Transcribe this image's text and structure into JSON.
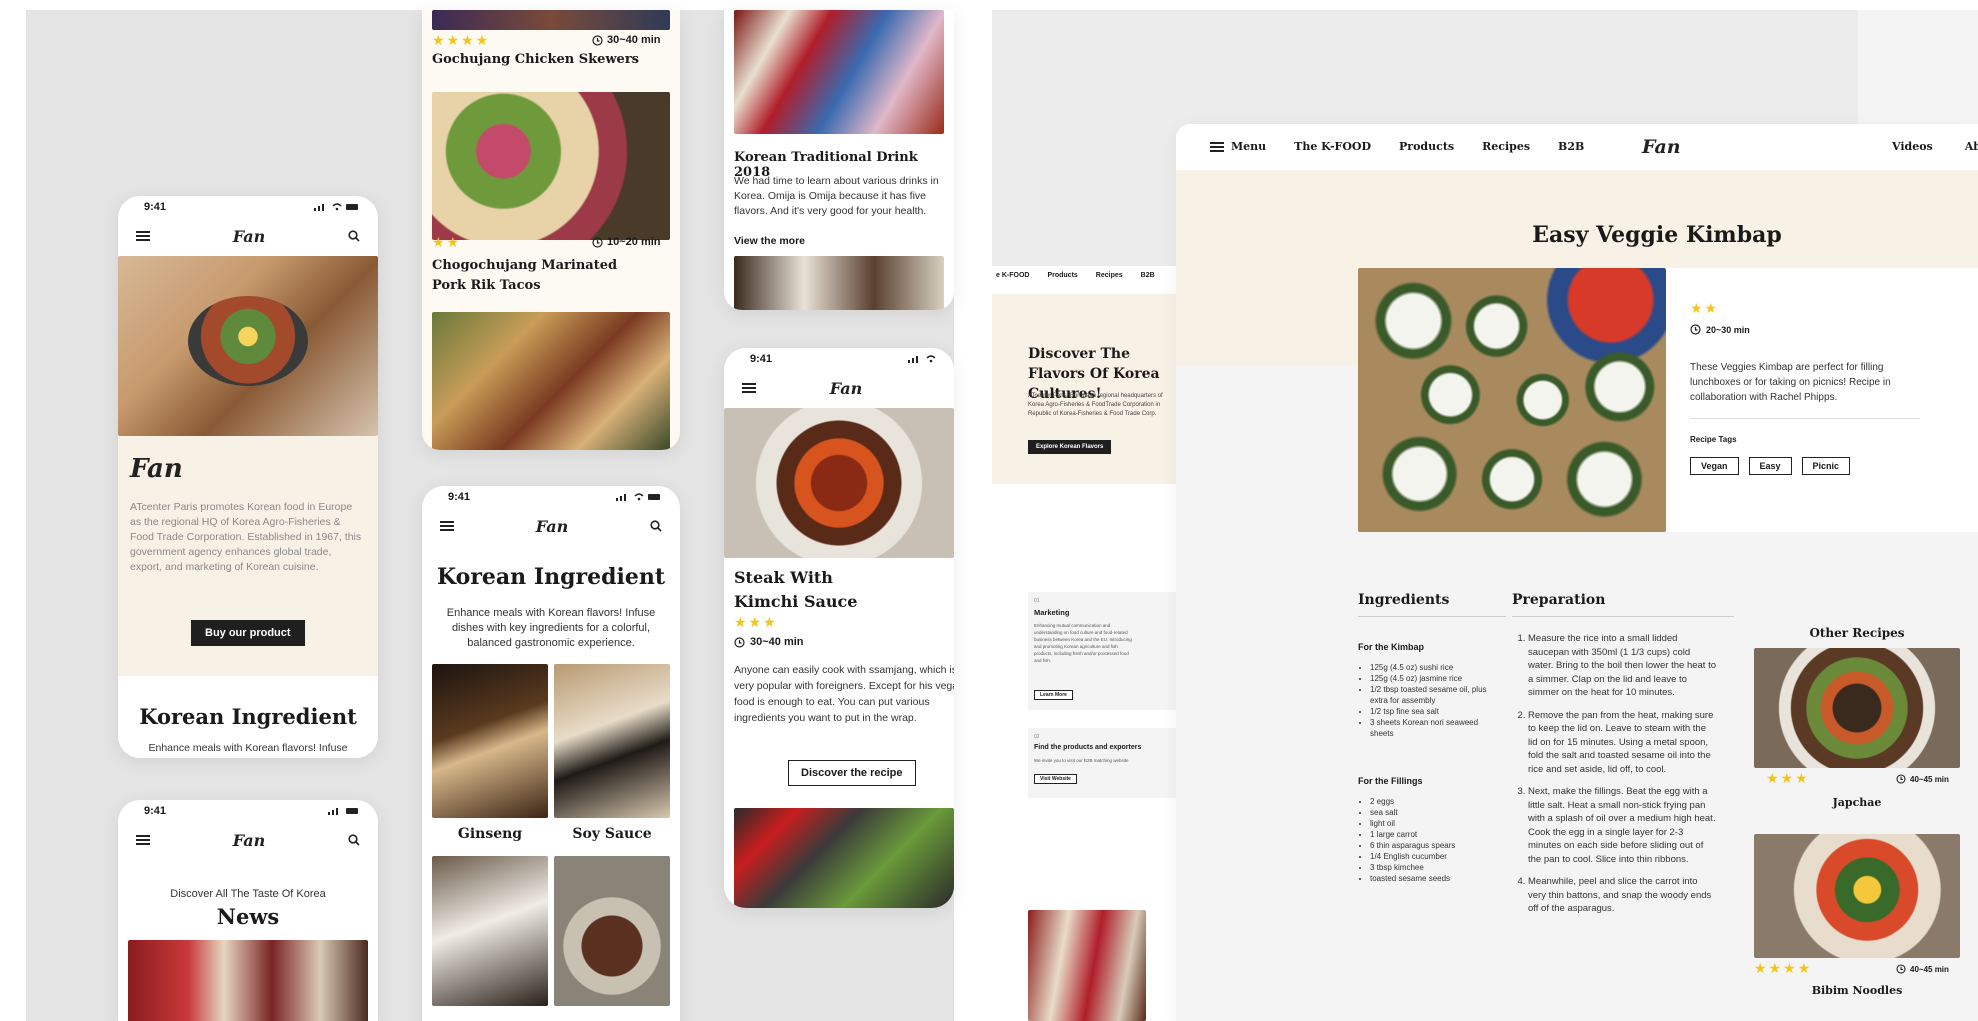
{
  "colors": {
    "accent_star": "#f3c51a",
    "cream": "#f8f1e6",
    "dark_button": "#1f1f1f",
    "page_bg": "#e6e6e6"
  },
  "phone_home": {
    "time": "9:41",
    "logo": "Fan",
    "about_logo": "Fan",
    "about_text": "ATcenter Paris promotes Korean food in Europe as the regional HQ of Korea Agro-Fisheries & Food Trade Corporation. Established in 1967, this government agency enhances global trade, export, and marketing of Korean cuisine.",
    "buy_button": "Buy our product",
    "section_title": "Korean Ingredient",
    "section_sub": "Enhance meals with Korean flavors! Infuse"
  },
  "phone_news": {
    "time": "9:41",
    "logo": "Fan",
    "kicker": "Discover All The Taste Of Korea",
    "title": "News"
  },
  "recipes_column": {
    "r1_stars": "★★★★",
    "r1_time": "30~40 min",
    "r1_title": "Gochujang Chicken Skewers",
    "r2_stars": "★★",
    "r2_time": "10~20 min",
    "r2_title": "Chogochujang Marinated Pork Rik Tacos"
  },
  "phone_ingredient": {
    "time": "9:41",
    "logo": "Fan",
    "title": "Korean Ingredient",
    "desc": "Enhance meals with Korean flavors! Infuse dishes with key ingredients for a colorful, balanced gastronomic experience.",
    "items": [
      {
        "label": "Ginseng"
      },
      {
        "label": "Soy Sauce"
      }
    ]
  },
  "drink_card": {
    "title": "Korean Traditional Drink 2018",
    "desc": "We had time to learn about various drinks in Korea. Omija is Omija because it has five flavors. And it's very good for your health.",
    "link": "View the more"
  },
  "phone_steak": {
    "time": "9:41",
    "logo": "Fan",
    "title": "Steak With Kimchi Sauce",
    "stars": "★★★",
    "time_label": "30~40 min",
    "desc": "Anyone can easily cook with ssamjang, which is very popular with foreigners. Except for his vegan food is enough to eat. You can put various ingredients you want to put in the wrap.",
    "button": "Discover the recipe"
  },
  "desktop_mid": {
    "nav": [
      "e K-FOOD",
      "Products",
      "Recipes",
      "B2B"
    ],
    "hero_title": "Discover The Flavors Of Korea Cultures!",
    "hero_desc": "ATcenter Paris, European regional headquarters of Korea Agro-Fisheries & FoodTrade Corporation in Republic of Korea-Fisheries & Food Trade Corp.",
    "hero_button": "Explore Korean Flavors",
    "card1_num": "01",
    "card1_title": "Marketing",
    "card1_desc": "Enhancing mutual communication and understanding on food culture and food-related business between Korea and the EU. Introducing and promoting Korean agriculture and fish products, including fresh and/or processed food and fish.",
    "card1_button": "Learn More",
    "card2_num": "02",
    "card2_title": "Find the products and exporters",
    "card2_desc": "We invite you to visit our B2B matching website",
    "card2_button": "Visit Website"
  },
  "desktop_main": {
    "nav_left": [
      "Menu",
      "The K-FOOD",
      "Products",
      "Recipes",
      "B2B"
    ],
    "logo": "Fan",
    "nav_right": [
      "Videos",
      "About"
    ],
    "title": "Easy Veggie Kimbap",
    "stars": "★★",
    "time_label": "20~30 min",
    "desc": "These Veggies Kimbap are perfect for filling lunchboxes or for taking on picnics! Recipe in collaboration with Rachel Phipps.",
    "tags_label": "Recipe Tags",
    "tags": [
      "Vegan",
      "Easy",
      "Picnic"
    ],
    "ingredients_title": "Ingredients",
    "kimbap_title": "For the Kimbap",
    "kimbap_items": [
      "125g (4.5 oz) sushi rice",
      "125g (4.5 oz) jasmine rice",
      "1/2 tbsp toasted sesame oil, plus extra for assembly",
      "1/2 tsp fine sea salt",
      "3 sheets Korean nori seaweed sheets"
    ],
    "fillings_title": "For the Fillings",
    "fillings_items": [
      "2 eggs",
      "sea salt",
      "light oil",
      "1 large carrot",
      "6 thin asparagus spears",
      "1/4 English cucumber",
      "3 tbsp kimchee",
      "toasted sesame seeds"
    ],
    "preparation_title": "Preparation",
    "steps": [
      "Measure the rice into a small lidded saucepan with 350ml (1 1/3 cups) cold water. Bring to the boil then lower the heat to a simmer. Clap on the lid and leave to simmer on the heat for 10 minutes.",
      "Remove the pan from the heat, making sure to keep the lid on. Leave to steam with the lid on for 15 minutes. Using a metal spoon, fold the salt and toasted sesame oil into the rice and set aside, lid off, to cool.",
      "Next, make the fillings. Beat the egg with a little salt. Heat a small non-stick frying pan with a splash of oil over a medium high heat. Cook the egg in a single layer for 2-3 minutes on each side before sliding out of the pan to cool. Slice into thin ribbons.",
      "Meanwhile, peel and slice the carrot into very thin battons, and snap the woody ends off of the asparagus."
    ],
    "other_title": "Other Recipes",
    "other": [
      {
        "stars": "★★★",
        "time": "40~45 min",
        "title": "Japchae"
      },
      {
        "stars": "★★★★",
        "time": "40~45 min",
        "title": "Bibim Noodles"
      }
    ]
  }
}
